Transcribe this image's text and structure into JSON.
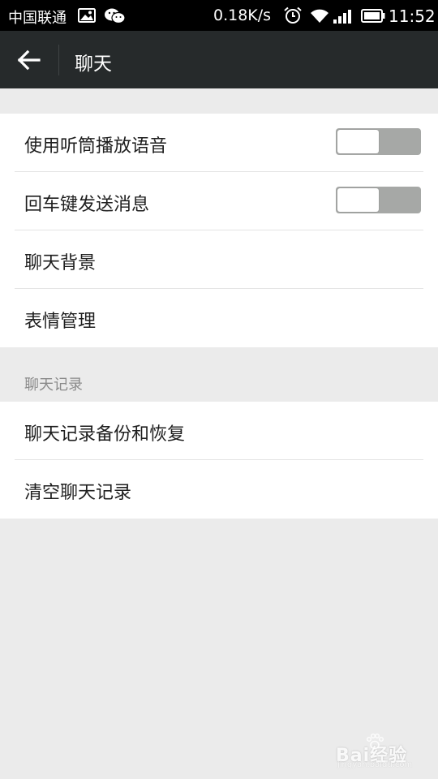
{
  "status_bar": {
    "carrier": "中国联通",
    "net_speed": "0.18K/s",
    "time": "11:52"
  },
  "header": {
    "title": "聊天"
  },
  "settings": {
    "group1": [
      {
        "label": "使用听筒播放语音",
        "toggle": "off"
      },
      {
        "label": "回车键发送消息",
        "toggle": "off"
      },
      {
        "label": "聊天背景"
      },
      {
        "label": "表情管理"
      }
    ],
    "section_header": "聊天记录",
    "group2": [
      {
        "label": "聊天记录备份和恢复"
      },
      {
        "label": "清空聊天记录"
      }
    ]
  },
  "watermark": {
    "text": "Bai经验",
    "url": "jingyan.baidu.com"
  },
  "colors": {
    "status_bar_bg": "#000000",
    "title_bar_bg": "#262a2b",
    "page_bg": "#ebebeb",
    "toggle_track": "#a6a8a6"
  }
}
